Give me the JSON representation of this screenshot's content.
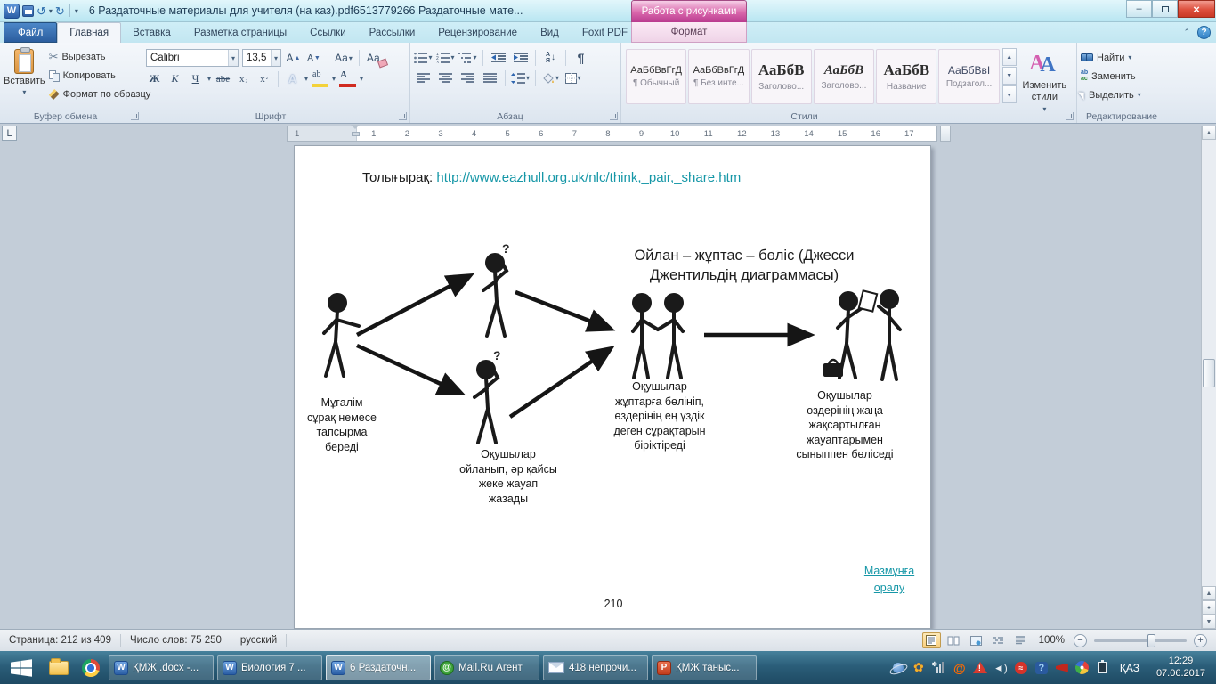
{
  "titlebar": {
    "title": "6 Раздаточные материалы для учителя (на каз).pdf6513779266 Раздаточные мате...",
    "contextual_group": "Работа с рисунками"
  },
  "tabs": {
    "file": "Файл",
    "home": "Главная",
    "insert": "Вставка",
    "layout": "Разметка страницы",
    "links": "Ссылки",
    "mailings": "Рассылки",
    "review": "Рецензирование",
    "view": "Вид",
    "foxit": "Foxit PDF",
    "format": "Формат"
  },
  "clipboard": {
    "paste": "Вставить",
    "cut": "Вырезать",
    "copy": "Копировать",
    "format_painter": "Формат по образцу",
    "group": "Буфер обмена"
  },
  "font": {
    "family": "Calibri",
    "size": "13,5",
    "group": "Шрифт"
  },
  "paragraph": {
    "group": "Абзац"
  },
  "styles": {
    "cards": [
      {
        "preview": "АаБбВвГгД",
        "label": "¶ Обычный"
      },
      {
        "preview": "АаБбВвГгД",
        "label": "¶ Без инте..."
      },
      {
        "preview": "АаБбВ",
        "label": "Заголово..."
      },
      {
        "preview": "АаБбВ",
        "label": "Заголово..."
      },
      {
        "preview": "АаБбВ",
        "label": "Название"
      },
      {
        "preview": "АаБбВвІ",
        "label": "Подзагол..."
      }
    ],
    "group": "Стили",
    "change_styles": "Изменить стили"
  },
  "editing": {
    "find": "Найти",
    "replace": "Заменить",
    "select": "Выделить",
    "group": "Редактирование"
  },
  "ruler": {
    "margin_number": "1",
    "numbers": [
      "1",
      "2",
      "3",
      "4",
      "5",
      "6",
      "7",
      "8",
      "9",
      "10",
      "11",
      "12",
      "13",
      "14",
      "15",
      "16",
      "17"
    ]
  },
  "document": {
    "intro_label": "Толығырақ:",
    "intro_link": "http://www.eazhull.org.uk/nlc/think,_pair,_share.htm",
    "diagram_title": "Ойлан – жұптас – бөліс (Джесси\nДжентильдің диаграммасы)",
    "captions": [
      "Мұғалім\nсұрақ немесе\nтапсырма\nбереді",
      "Оқушылар\nойланып, әр қайсы\nжеке  жауап\nжазады",
      "Оқушылар\nжұптарға бөлініп,\nөздерінің ең  үздік\nдеген  сұрақтарын\nбіріктіреді",
      "Оқушылар\nөздерінің жаңа\nжақсартылған\nжауаптарымен\nсыныппен бөліседі"
    ],
    "back_link": "Мазмұнға\nоралу",
    "page_number": "210"
  },
  "statusbar": {
    "page_info": "Страница: 212 из 409",
    "word_count": "Число слов: 75 250",
    "language": "русский",
    "zoom_level": "100%"
  },
  "taskbar": {
    "buttons": [
      {
        "label": "ҚМЖ .docx -..."
      },
      {
        "label": "Биология  7 ..."
      },
      {
        "label": "6 Раздаточн..."
      },
      {
        "label": "Mail.Ru Агент"
      },
      {
        "label": "418 непрочи..."
      },
      {
        "label": "ҚМЖ таныс..."
      }
    ],
    "language": "ҚАЗ",
    "time": "12:29",
    "date": "07.06.2017"
  }
}
